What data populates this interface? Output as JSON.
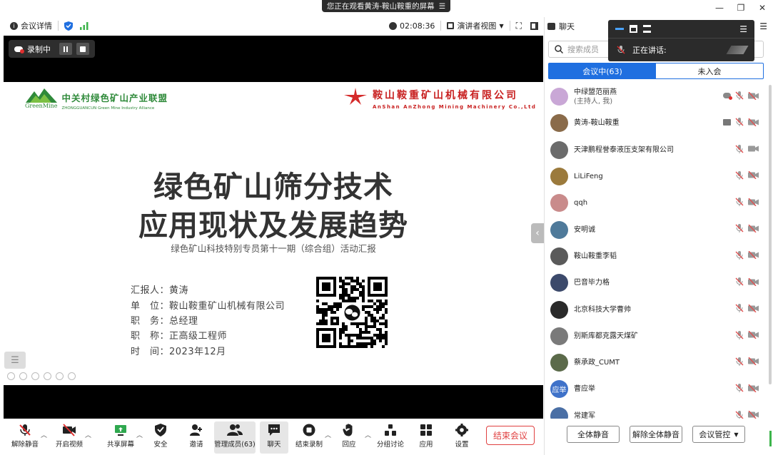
{
  "banner": {
    "text": "您正在观看黄涛-鞍山鞍重的屏幕"
  },
  "infobar": {
    "meeting_details": "会议详情",
    "timer": "02:08:36",
    "view_mode": "演讲者视图"
  },
  "recording": {
    "label": "录制中"
  },
  "slide": {
    "green_logo_cn": "中关村绿色矿山产业联盟",
    "green_logo_brand": "GreenMine",
    "green_logo_en": "ZHONGGUANCUN Green Mine Industry Alliance",
    "red_logo_cn": "鞍山鞍重矿山机械有限公司",
    "red_logo_en": "AnShan AnZhong Mining Machinery Co.,Ltd",
    "title_line1": "绿色矿山筛分技术",
    "title_line2": "应用现状及发展趋势",
    "subtitle": "绿色矿山科技特别专员第十一期（综合组）活动汇报",
    "rows": [
      "汇报人：黄涛",
      "单　位：鞍山鞍重矿山机械有限公司",
      "职　务：总经理",
      "职　称：正高级工程师",
      "时　间：2023年12月"
    ]
  },
  "toolbar": {
    "items": [
      {
        "label": "解除静音"
      },
      {
        "label": "开启视频"
      },
      {
        "label": "共享屏幕"
      },
      {
        "label": "安全"
      },
      {
        "label": "邀请"
      },
      {
        "label": "管理成员(63)"
      },
      {
        "label": "聊天"
      },
      {
        "label": "结束录制"
      },
      {
        "label": "回应"
      },
      {
        "label": "分组讨论"
      },
      {
        "label": "应用"
      },
      {
        "label": "设置"
      }
    ],
    "end_meeting": "结束会议"
  },
  "panel": {
    "chat_label": "聊天",
    "search_placeholder": "搜索成员",
    "tab_in": "会议中(63)",
    "tab_out": "未入会",
    "members": [
      {
        "name": "中绿盟范丽燕",
        "sub": "(主持人, 我)",
        "avatar_color": "#c9a7d6"
      },
      {
        "name": "黄涛-鞍山鞍重",
        "avatar_color": "#8a6b4a"
      },
      {
        "name": "天津鹏程誉泰液压支架有限公司",
        "avatar_color": "#6b6b6b"
      },
      {
        "name": "LiLiFeng",
        "avatar_color": "#9b7a3c"
      },
      {
        "name": "qqh",
        "avatar_color": "#c98b8b"
      },
      {
        "name": "安明诚",
        "avatar_color": "#4f7a9a"
      },
      {
        "name": "鞍山鞍重李韬",
        "avatar_color": "#5a5a5a"
      },
      {
        "name": "巴音毕力格",
        "avatar_color": "#3c4a6b"
      },
      {
        "name": "北京科技大学曹帅",
        "avatar_color": "#2a2a2a"
      },
      {
        "name": "别斯库都克露天煤矿",
        "avatar_color": "#7a7a7a"
      },
      {
        "name": "蔡承政_CUMT",
        "avatar_color": "#5b6a4a"
      },
      {
        "name": "曹应举",
        "avatar_text": "应举",
        "avatar_color": "#3f72c9"
      },
      {
        "name": "常建军",
        "avatar_color": "#4a6fa5"
      }
    ],
    "mute_all": "全体静音",
    "unmute_all": "解除全体静音",
    "meeting_control": "会议管控"
  },
  "float": {
    "speaking_label": "正在讲话:"
  }
}
